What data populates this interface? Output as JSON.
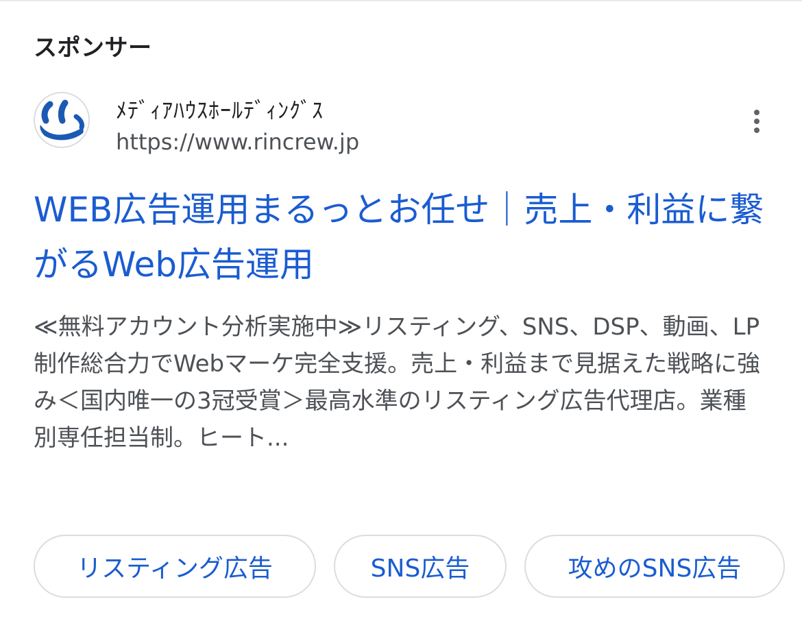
{
  "sponsor_label": "スポンサー",
  "advertiser": {
    "name": "ﾒﾃﾞｨｱﾊｳｽﾎｰﾙﾃﾞｨﾝｸﾞｽ",
    "url": "https://www.rincrew.jp",
    "favicon": "smile-logo-icon",
    "menu_icon": "more-vert-icon"
  },
  "ad": {
    "title": "WEB広告運用まるっとお任せ｜売上・利益に繋がるWeb広告運用",
    "description": "≪無料アカウント分析実施中≫リスティング、SNS、DSP、動画、LP制作総合力でWebマーケ完全支援。売上・利益まで見据えた戦略に強み＜国内唯一の3冠受賞＞最高水準のリスティング広告代理店。業種別専任担当制。ヒート..."
  },
  "sitelinks": [
    {
      "label": "リスティング広告"
    },
    {
      "label": "SNS広告"
    },
    {
      "label": "攻めのSNS広告"
    },
    {
      "label": ""
    }
  ],
  "colors": {
    "link": "#1a5cd1",
    "text": "#202124",
    "secondary_text": "#4d5156",
    "border": "#dadce0",
    "logo_blue": "#1b5ab4"
  }
}
